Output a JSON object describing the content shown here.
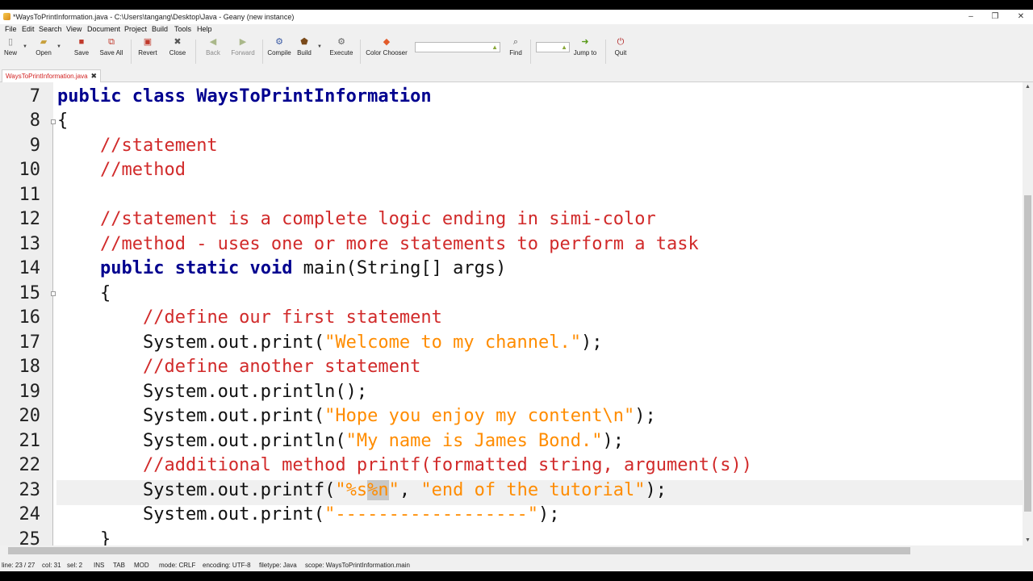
{
  "window": {
    "title": "*WaysToPrintInformation.java - C:\\Users\\tangang\\Desktop\\Java - Geany (new instance)",
    "controls": {
      "minimize": "–",
      "maximize": "❐",
      "close": "✕"
    }
  },
  "menu": [
    "File",
    "Edit",
    "Search",
    "View",
    "Document",
    "Project",
    "Build",
    "Tools",
    "Help"
  ],
  "toolbar": {
    "new": "New",
    "open": "Open",
    "save": "Save",
    "save_all": "Save All",
    "revert": "Revert",
    "close": "Close",
    "back": "Back",
    "forward": "Forward",
    "compile": "Compile",
    "build": "Build",
    "execute": "Execute",
    "color_chooser": "Color Chooser",
    "search_value": "",
    "find": "Find",
    "jump_value": "",
    "jump_to": "Jump to",
    "quit": "Quit"
  },
  "tab": {
    "label": "WaysToPrintInformation.java",
    "close": "✖"
  },
  "editor": {
    "current_line": 23,
    "lines": [
      {
        "n": "7"
      },
      {
        "n": "8"
      },
      {
        "n": "9"
      },
      {
        "n": "10"
      },
      {
        "n": "11"
      },
      {
        "n": "12"
      },
      {
        "n": "13"
      },
      {
        "n": "14"
      },
      {
        "n": "15"
      },
      {
        "n": "16"
      },
      {
        "n": "17"
      },
      {
        "n": "18"
      },
      {
        "n": "19"
      },
      {
        "n": "20"
      },
      {
        "n": "21"
      },
      {
        "n": "22"
      },
      {
        "n": "23"
      },
      {
        "n": "24"
      },
      {
        "n": "25"
      }
    ],
    "code": {
      "l7": {
        "kw1": "public",
        "kw2": "class",
        "cls": "WaysToPrintInformation"
      },
      "l8": "{",
      "l9": "//statement",
      "l10": "//method",
      "l12": "//statement is a complete logic ending in simi-color",
      "l13": "//method - uses one or more statements to perform a task",
      "l14": {
        "kw1": "public",
        "kw2": "static",
        "kw3": "void",
        "rest": " main(String[] args)"
      },
      "l15": "{",
      "l16": "//define our first statement",
      "l17": {
        "pre": "System.out.print(",
        "str": "\"Welcome to my channel.\"",
        "post": ");"
      },
      "l18": "//define another statement",
      "l19": "System.out.println();",
      "l20": {
        "pre": "System.out.print(",
        "str": "\"Hope you enjoy my content\\n\"",
        "post": ");"
      },
      "l21": {
        "pre": "System.out.println(",
        "str": "\"My name is James Bond.\"",
        "post": ");"
      },
      "l22": "//additional method printf(formatted string, argument(s))",
      "l23": {
        "pre": "System.out.printf(",
        "str1": "\"%s",
        "sel": "%n",
        "str2": "\"",
        "mid": ", ",
        "str3": "\"end of the tutorial\"",
        "post": ");"
      },
      "l24": {
        "pre": "System.out.print(",
        "str": "\"------------------\"",
        "post": ");"
      },
      "l25": "}"
    }
  },
  "status": {
    "line": "line: 23 / 27",
    "col": "col: 31",
    "sel": "sel: 2",
    "ins": "INS",
    "tab": "TAB",
    "mod": "MOD",
    "mode": "mode: CRLF",
    "encoding": "encoding: UTF-8",
    "filetype": "filetype: Java",
    "scope": "scope: WaysToPrintInformation.main"
  }
}
